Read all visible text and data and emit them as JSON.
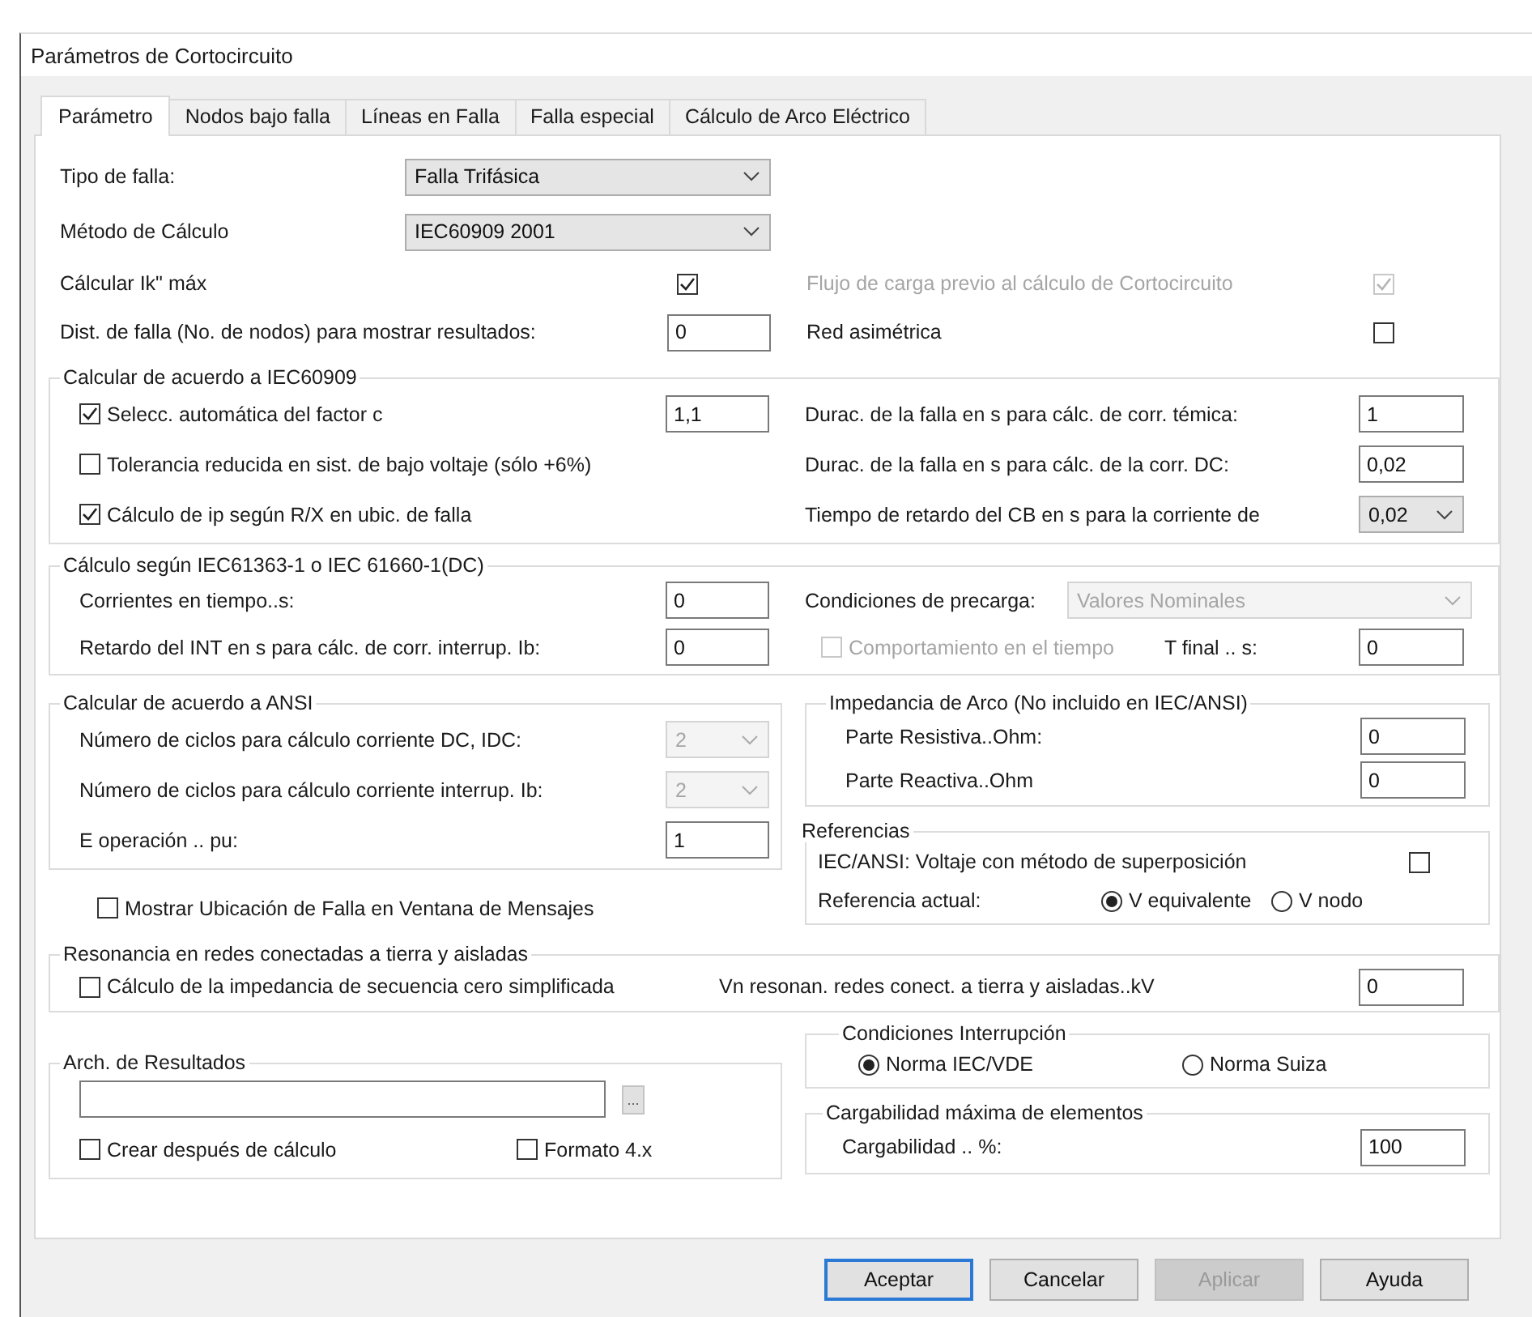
{
  "window": {
    "title": "Parámetros de Cortocircuito"
  },
  "tabs": [
    {
      "label": "Parámetro",
      "selected": true
    },
    {
      "label": "Nodos bajo falla",
      "selected": false
    },
    {
      "label": "Líneas en Falla",
      "selected": false
    },
    {
      "label": "Falla especial",
      "selected": false
    },
    {
      "label": "Cálculo de Arco Eléctrico",
      "selected": false
    }
  ],
  "general": {
    "rows": [
      {
        "left_label": {
          "kind": "label",
          "text": "Tipo de falla:",
          "disabled": false
        },
        "left_control": {
          "kind": "dropdown",
          "value": "Falla Trifásica",
          "disabled": false
        }
      },
      {
        "left_label": {
          "kind": "label",
          "text": "Método de Cálculo",
          "disabled": false
        },
        "left_control": {
          "kind": "dropdown",
          "value": "IEC60909 2001",
          "disabled": false
        }
      },
      {
        "left_label": {
          "kind": "label",
          "text": "Cálcular Ik\" máx",
          "disabled": false
        },
        "left_control": {
          "kind": "checkbox",
          "checked": true,
          "disabled": false
        },
        "right_label": {
          "kind": "label",
          "text": "Flujo de carga previo al cálculo de Cortocircuito",
          "disabled": true
        },
        "right_control": {
          "kind": "checkbox",
          "checked": true,
          "disabled": true
        }
      },
      {
        "left_label": {
          "kind": "label",
          "text": "Dist. de falla (No. de nodos) para mostrar resultados:",
          "disabled": false
        },
        "left_control": {
          "kind": "input",
          "value": "0"
        },
        "right_label": {
          "kind": "label",
          "text": "Red asimétrica",
          "disabled": false
        },
        "right_control": {
          "kind": "checkbox",
          "checked": false,
          "disabled": false
        }
      }
    ]
  },
  "iec60909": {
    "title": "Calcular de acuerdo a IEC60909",
    "rows": [
      {
        "option": {
          "kind": "checkbox",
          "label": "Selecc. automática del factor c",
          "checked": true,
          "disabled": false
        },
        "factor": {
          "kind": "input",
          "value": "1,1"
        },
        "setting_label": {
          "kind": "label",
          "text": "Durac. de la falla en s para cálc. de corr. témica:",
          "disabled": false
        },
        "setting_value": {
          "kind": "input",
          "value": "1"
        }
      },
      {
        "option": {
          "kind": "checkbox",
          "label": "Tolerancia reducida en sist. de bajo voltaje (sólo +6%)",
          "checked": false,
          "disabled": false
        },
        "setting_label": {
          "kind": "label",
          "text": "Durac. de la falla en s para cálc. de la corr. DC:",
          "disabled": false
        },
        "setting_value": {
          "kind": "input",
          "value": "0,02"
        }
      },
      {
        "option": {
          "kind": "checkbox",
          "label": "Cálculo de ip según R/X en ubic. de falla",
          "checked": true,
          "disabled": false
        },
        "setting_label": {
          "kind": "label",
          "text": "Tiempo de retardo del CB en s para la corriente de",
          "disabled": false
        },
        "setting_value": {
          "kind": "dropdown",
          "value": "0,02",
          "disabled": false
        }
      }
    ]
  },
  "iec61363": {
    "title": "Cálculo según IEC61363-1 o IEC 61660-1(DC)",
    "rows": [
      {
        "left_label": {
          "kind": "label",
          "text": "Corrientes en tiempo..s:",
          "disabled": false
        },
        "left_value": {
          "kind": "input",
          "value": "0"
        },
        "preload_label": {
          "kind": "label",
          "text": "Condiciones de precarga:",
          "disabled": false
        },
        "preload_value": {
          "kind": "dropdown",
          "value": "Valores Nominales",
          "disabled": true
        }
      },
      {
        "left_label": {
          "kind": "label",
          "text": "Retardo del INT en s para cálc. de corr. interrup. Ib:",
          "disabled": false
        },
        "left_value": {
          "kind": "input",
          "value": "0"
        },
        "time_behaviour": {
          "kind": "checkbox",
          "label": "Comportamiento en el tiempo",
          "checked": false,
          "disabled": true
        },
        "t_final_label": {
          "kind": "label",
          "text": "T final .. s:",
          "disabled": false
        },
        "t_final_value": {
          "kind": "input",
          "value": "0"
        }
      }
    ]
  },
  "ansi": {
    "title": "Calcular de acuerdo a ANSI",
    "rows": [
      {
        "label": {
          "kind": "label",
          "text": "Número de ciclos para cálculo corriente DC, IDC:",
          "disabled": false
        },
        "value": {
          "kind": "dropdown",
          "value": "2",
          "disabled": true
        }
      },
      {
        "label": {
          "kind": "label",
          "text": "Número de ciclos para cálculo corriente interrup. Ib:",
          "disabled": false
        },
        "value": {
          "kind": "dropdown",
          "value": "2",
          "disabled": true
        }
      },
      {
        "label": {
          "kind": "label",
          "text": "E operación .. pu:",
          "disabled": false
        },
        "value": {
          "kind": "input",
          "value": "1"
        }
      }
    ]
  },
  "show_location": {
    "rows": [
      {
        "option": {
          "kind": "checkbox",
          "label": "Mostrar Ubicación de Falla en Ventana de Mensajes",
          "checked": false,
          "disabled": false
        }
      }
    ]
  },
  "arc_impedance": {
    "title": "Impedancia de Arco (No incluido en IEC/ANSI)",
    "rows": [
      {
        "label": {
          "kind": "label",
          "text": "Parte Resistiva..Ohm:",
          "disabled": false
        },
        "value": {
          "kind": "input",
          "value": "0"
        }
      },
      {
        "label": {
          "kind": "label",
          "text": "Parte Reactiva..Ohm",
          "disabled": false
        },
        "value": {
          "kind": "input",
          "value": "0"
        }
      }
    ]
  },
  "references": {
    "title": "Referencias",
    "rows": [
      {
        "label": {
          "kind": "label",
          "text": "IEC/ANSI: Voltaje con método de superposición",
          "disabled": false
        },
        "superposition": {
          "kind": "checkbox",
          "checked": false,
          "disabled": false
        }
      },
      {
        "label": {
          "kind": "label",
          "text": "Referencia actual:",
          "disabled": false
        },
        "equivalent": {
          "kind": "radio",
          "label": "V equivalente",
          "selected": true
        },
        "node": {
          "kind": "radio",
          "label": "V nodo",
          "selected": false
        }
      }
    ]
  },
  "resonance": {
    "title": "Resonancia en redes conectadas a tierra y aisladas",
    "rows": [
      {
        "option": {
          "kind": "checkbox",
          "label": "Cálculo de la impedancia de secuencia cero simplificada",
          "checked": false,
          "disabled": false
        },
        "vn_label": {
          "kind": "label",
          "text": "Vn resonan. redes conect. a tierra y aisladas..kV",
          "disabled": false
        },
        "vn_value": {
          "kind": "input",
          "value": "0"
        }
      }
    ]
  },
  "results_file": {
    "title": "Arch. de Resultados",
    "rows": [
      {
        "path": {
          "kind": "input"
        },
        "browse": {
          "kind": "button",
          "label": "..."
        }
      },
      {
        "create": {
          "kind": "checkbox",
          "label": "Crear después de cálculo",
          "checked": false,
          "disabled": false
        },
        "format": {
          "kind": "checkbox",
          "label": "Formato 4.x",
          "checked": false,
          "disabled": false
        }
      }
    ]
  },
  "interruption": {
    "title": "Condiciones Interrupción",
    "rows": [
      {
        "iec_vde": {
          "kind": "radio",
          "label": "Norma IEC/VDE",
          "selected": true
        },
        "swiss": {
          "kind": "radio",
          "label": "Norma Suiza",
          "selected": false
        }
      }
    ]
  },
  "max_loading": {
    "title": "Cargabilidad máxima de elementos",
    "rows": [
      {
        "label": {
          "kind": "label",
          "text": "Cargabilidad .. %:",
          "disabled": false
        },
        "value": {
          "kind": "input",
          "value": "100"
        }
      }
    ]
  },
  "buttons": [
    {
      "label": "Aceptar",
      "default": true,
      "disabled": false
    },
    {
      "label": "Cancelar",
      "default": false,
      "disabled": false
    },
    {
      "label": "Aplicar",
      "default": false,
      "disabled": true
    },
    {
      "label": "Ayuda",
      "default": false,
      "disabled": false
    }
  ]
}
